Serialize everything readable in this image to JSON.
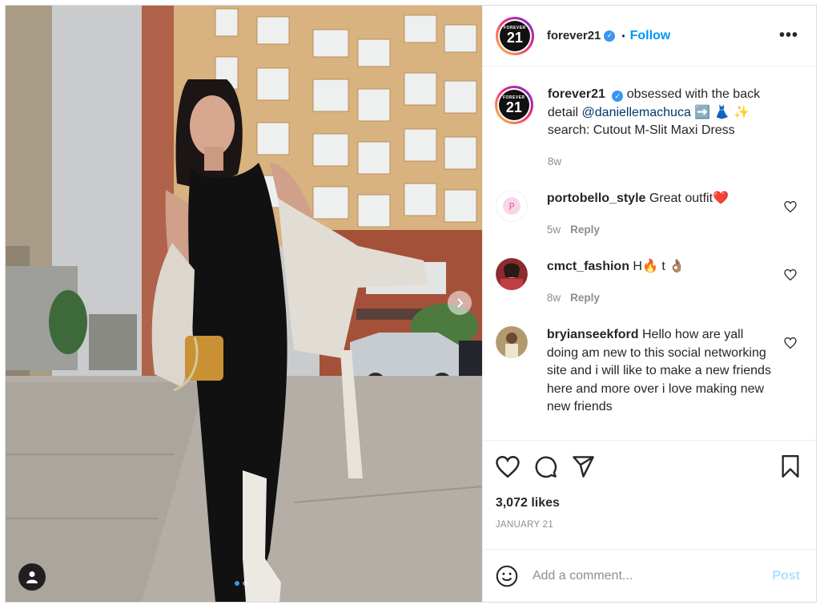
{
  "post": {
    "username": "forever21",
    "follow_label": "Follow",
    "bullet": "•",
    "more_label": "•••",
    "logo_top": "FOREVER",
    "logo_num": "21"
  },
  "caption": {
    "username": "forever21",
    "text_before": "obsessed with the back detail",
    "mention": "@daniellemachuca",
    "emojis": "➡️ 👗 ✨",
    "line2": "search: Cutout M-Slit Maxi Dress",
    "age": "8w"
  },
  "comments": [
    {
      "username": "portobello_style",
      "text": "Great outfit",
      "emoji": "❤️",
      "age": "5w",
      "reply": "Reply"
    },
    {
      "username": "cmct_fashion",
      "text": "H",
      "emoji": "🔥",
      "text2": "t",
      "emoji2": "👌🏽",
      "age": "8w",
      "reply": "Reply"
    },
    {
      "username": "bryianseekford",
      "text": "Hello how are yall doing am new to this social networking site and i will like to make a new friends here and more over i love making new new friends"
    }
  ],
  "likes": "3,072 likes",
  "date": "JANUARY 21",
  "add_comment": {
    "placeholder": "Add a comment...",
    "post_label": "Post"
  },
  "colors": {
    "accent": "#0095f6",
    "post_disabled": "#b2dffc",
    "muted": "#8e8e8e"
  },
  "icons": [
    "chevron-right-icon",
    "user-tag-icon",
    "heart-icon",
    "comment-icon",
    "share-icon",
    "bookmark-icon",
    "emoji-icon",
    "verified-icon",
    "more-icon"
  ]
}
